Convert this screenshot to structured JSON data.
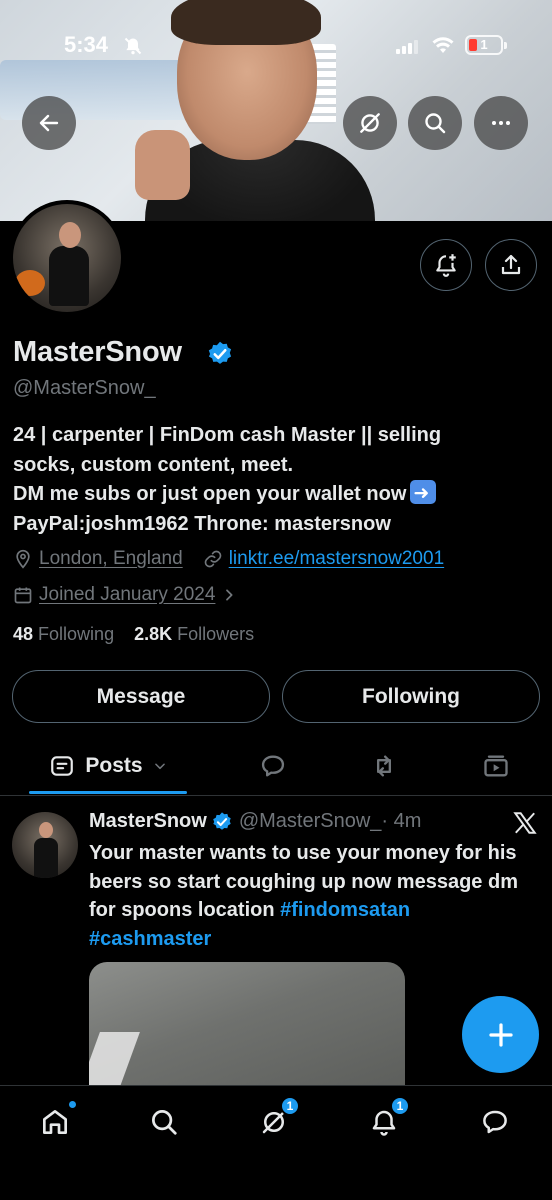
{
  "status_bar": {
    "time": "5:34",
    "battery_level": "1"
  },
  "profile": {
    "display_name": "MasterSnow",
    "handle": "@MasterSnow_",
    "bio_lines": [
      "24 | carpenter | FinDom cash Master || selling",
      "socks, custom content, meet.",
      "DM me subs or just open your wallet now",
      "PayPal:joshm1962 Throne: mastersnow"
    ],
    "location": "London, England",
    "website": "linktr.ee/mastersnow2001",
    "joined": "Joined January 2024",
    "following_count": "48",
    "following_label": "Following",
    "followers_count": "2.8K",
    "followers_label": "Followers"
  },
  "actions": {
    "message_label": "Message",
    "following_label": "Following"
  },
  "tabs": {
    "posts_label": "Posts"
  },
  "post": {
    "author_name": "MasterSnow",
    "author_handle": "@MasterSnow_",
    "time": "· 4m",
    "text": "Your master wants to use your money for his beers so start coughing up now message dm for spoons location",
    "hashtags": "#findomsatan #cashmaster"
  },
  "bottom_nav": {
    "grok_badge": "1",
    "notifications_badge": "1"
  },
  "colors": {
    "accent": "#1d9bf0",
    "muted": "#71767b",
    "border": "#536471"
  }
}
